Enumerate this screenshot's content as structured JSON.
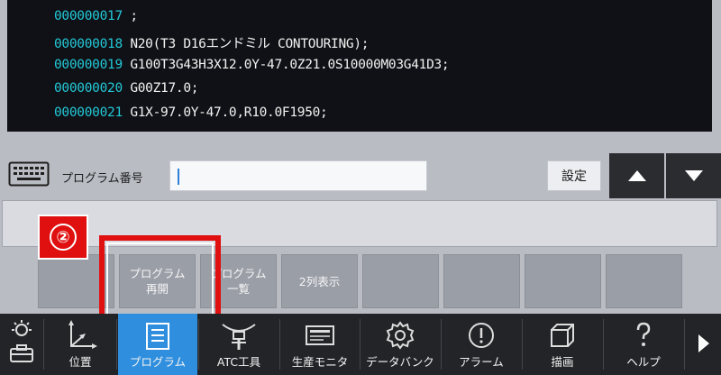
{
  "code_lines": [
    {
      "num": "000000017",
      "text": ";"
    },
    {
      "num": "000000018",
      "text": "N20(T3 D16エンドミル CONTOURING);"
    },
    {
      "num": "000000019",
      "text": "G100T3G43H3X12.0Y-47.0Z21.0S10000M03G41D3;"
    },
    {
      "num": "000000020",
      "text": "G00Z17.0;"
    },
    {
      "num": "000000021",
      "text": "G1X-97.0Y-47.0,R10.0F1950;"
    }
  ],
  "input_row": {
    "label": "プログラム番号",
    "value": "",
    "set_label": "設定"
  },
  "soft_keys": [
    {
      "line1": "",
      "line2": ""
    },
    {
      "line1": "プログラム",
      "line2": "再開"
    },
    {
      "line1": "プログラム",
      "line2": "一覧"
    },
    {
      "line1": "2列表示",
      "line2": ""
    },
    {
      "line1": "",
      "line2": ""
    },
    {
      "line1": "",
      "line2": ""
    },
    {
      "line1": "",
      "line2": ""
    },
    {
      "line1": "",
      "line2": ""
    }
  ],
  "marker": {
    "label": "②"
  },
  "bottom_nav": [
    {
      "label": "位置"
    },
    {
      "label": "プログラム"
    },
    {
      "label": "ATC工具"
    },
    {
      "label": "生産モニタ"
    },
    {
      "label": "データバンク"
    },
    {
      "label": "アラーム"
    },
    {
      "label": "描画"
    },
    {
      "label": "ヘルプ"
    }
  ],
  "colors": {
    "line_number": "#23c8d6",
    "code_text": "#f2f2f2",
    "active_tab": "#2f8fde",
    "highlight": "#e01010"
  }
}
